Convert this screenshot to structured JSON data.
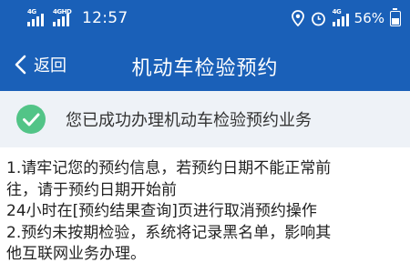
{
  "status_bar": {
    "network_1": "4G",
    "network_2": "4GHD",
    "time": "12:57",
    "network_3": "4G",
    "battery": "56%",
    "icons": [
      "location-icon",
      "alarm-icon",
      "signal-icon",
      "battery-icon"
    ],
    "battery_level": 0.56
  },
  "nav": {
    "back_label": "返回",
    "title": "机动车检验预约"
  },
  "notice": {
    "icon": "check-circle-icon",
    "text": "您已成功办理机动车检验预约业务"
  },
  "rules": {
    "lines": [
      "1.请牢记您的预约信息，若预约日期不能正常前",
      "往，请于预约日期开始前",
      "24小时在[预约结果查询]页进行取消预约操作",
      "2.预约未按期检验，系统将记录黑名单，影响其",
      "他互联网业务办理。"
    ]
  },
  "colors": {
    "header_bg": "#1a60b8",
    "notice_bg": "#eef2f7",
    "check_green": "#52c487",
    "text": "#222222"
  }
}
